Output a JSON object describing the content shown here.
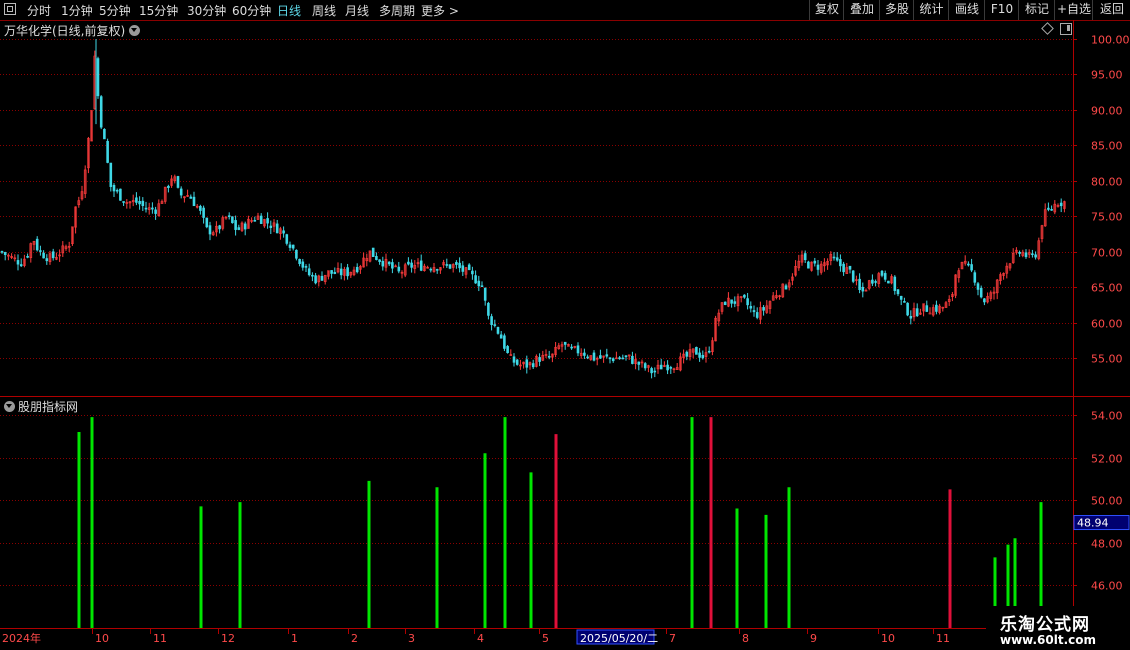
{
  "window": {
    "periods": [
      {
        "label": "分时",
        "active": false
      },
      {
        "label": "1分钟",
        "active": false
      },
      {
        "label": "5分钟",
        "active": false
      },
      {
        "label": "15分钟",
        "active": false
      },
      {
        "label": "30分钟",
        "active": false
      },
      {
        "label": "60分钟",
        "active": false
      },
      {
        "label": "日线",
        "active": true
      },
      {
        "label": "周线",
        "active": false
      },
      {
        "label": "月线",
        "active": false
      },
      {
        "label": "多周期",
        "active": false
      },
      {
        "label": "更多 >",
        "active": false
      }
    ],
    "right_buttons": [
      "复权",
      "叠加",
      "多股",
      "统计",
      "画线",
      "F10",
      "标记",
      "+自选",
      "返回"
    ]
  },
  "main_panel": {
    "title": "万华化学(日线,前复权)"
  },
  "indicator_panel": {
    "title": "股朋指标网"
  },
  "footer": {
    "logo_cn": "乐淘公式网",
    "logo_url": "www.60lt.com"
  },
  "colors": {
    "up": "#ff3c3c",
    "down": "#3fd8e6",
    "ind_green": "#00e600",
    "ind_red": "#e0103a",
    "grid": "#8a0000",
    "axis_text": "#ff4a4a",
    "cursor_bg": "#000070"
  },
  "chart_data": [
    {
      "type": "candlestick",
      "title": "万华化学(日线,前复权)",
      "y_ticks": [
        55,
        60,
        65,
        70,
        75,
        80,
        85,
        90,
        95,
        100
      ],
      "y_tick_labels": [
        "55.00",
        "60.00",
        "65.00",
        "70.00",
        "75.00",
        "80.00",
        "85.00",
        "90.00",
        "95.00",
        "100.00"
      ],
      "approx_close_path": [
        [
          0,
          70
        ],
        [
          12,
          69
        ],
        [
          20,
          68.5
        ],
        [
          26,
          69.5
        ],
        [
          32,
          72
        ],
        [
          38,
          70
        ],
        [
          50,
          69
        ],
        [
          60,
          70
        ],
        [
          68,
          71
        ],
        [
          74,
          76
        ],
        [
          80,
          78
        ],
        [
          86,
          84
        ],
        [
          90,
          89
        ],
        [
          94,
          98
        ],
        [
          98,
          90
        ],
        [
          104,
          85
        ],
        [
          110,
          79
        ],
        [
          118,
          78
        ],
        [
          126,
          77
        ],
        [
          136,
          77
        ],
        [
          146,
          76
        ],
        [
          156,
          76
        ],
        [
          166,
          79
        ],
        [
          172,
          81
        ],
        [
          178,
          78
        ],
        [
          188,
          78
        ],
        [
          198,
          76
        ],
        [
          206,
          73
        ],
        [
          216,
          73
        ],
        [
          226,
          75
        ],
        [
          236,
          73
        ],
        [
          246,
          74
        ],
        [
          256,
          75
        ],
        [
          268,
          74
        ],
        [
          280,
          73
        ],
        [
          290,
          71
        ],
        [
          298,
          69
        ],
        [
          306,
          67
        ],
        [
          316,
          66
        ],
        [
          326,
          67
        ],
        [
          336,
          67
        ],
        [
          346,
          67
        ],
        [
          358,
          68
        ],
        [
          368,
          70
        ],
        [
          378,
          69
        ],
        [
          388,
          68
        ],
        [
          398,
          67
        ],
        [
          410,
          68
        ],
        [
          422,
          68
        ],
        [
          434,
          68
        ],
        [
          444,
          68
        ],
        [
          454,
          68
        ],
        [
          466,
          67
        ],
        [
          476,
          66
        ],
        [
          482,
          65
        ],
        [
          486,
          61
        ],
        [
          492,
          60
        ],
        [
          500,
          58
        ],
        [
          508,
          55
        ],
        [
          518,
          54
        ],
        [
          528,
          54
        ],
        [
          538,
          55
        ],
        [
          550,
          55
        ],
        [
          560,
          57
        ],
        [
          570,
          56
        ],
        [
          580,
          56
        ],
        [
          592,
          55
        ],
        [
          604,
          55
        ],
        [
          616,
          55
        ],
        [
          628,
          55
        ],
        [
          640,
          54
        ],
        [
          652,
          53
        ],
        [
          662,
          54
        ],
        [
          672,
          54
        ],
        [
          684,
          55
        ],
        [
          694,
          56
        ],
        [
          704,
          55
        ],
        [
          710,
          57
        ],
        [
          716,
          61
        ],
        [
          724,
          63
        ],
        [
          734,
          63
        ],
        [
          744,
          63
        ],
        [
          754,
          61
        ],
        [
          764,
          62
        ],
        [
          774,
          64
        ],
        [
          784,
          65
        ],
        [
          792,
          67
        ],
        [
          800,
          69
        ],
        [
          810,
          68
        ],
        [
          820,
          68
        ],
        [
          830,
          69
        ],
        [
          840,
          68
        ],
        [
          850,
          67
        ],
        [
          860,
          64
        ],
        [
          870,
          66
        ],
        [
          880,
          67
        ],
        [
          890,
          66
        ],
        [
          900,
          63
        ],
        [
          910,
          61
        ],
        [
          920,
          62
        ],
        [
          930,
          62
        ],
        [
          940,
          62
        ],
        [
          950,
          63
        ],
        [
          956,
          68
        ],
        [
          964,
          68
        ],
        [
          972,
          67
        ],
        [
          982,
          63
        ],
        [
          992,
          64
        ],
        [
          1000,
          67
        ],
        [
          1010,
          69
        ],
        [
          1020,
          70
        ],
        [
          1030,
          69
        ],
        [
          1036,
          70
        ],
        [
          1042,
          75
        ],
        [
          1050,
          76
        ],
        [
          1056,
          77
        ],
        [
          1062,
          77
        ]
      ]
    },
    {
      "type": "bar",
      "title": "股朋指标网",
      "y_ticks": [
        46,
        48,
        50,
        52,
        54
      ],
      "y_tick_labels": [
        "46.00",
        "48.00",
        "50.00",
        "52.00",
        "54.00"
      ],
      "cursor_value": "48.94",
      "x_tick_labels": [
        "2024年",
        "10",
        "11",
        "12",
        "1",
        "2",
        "3",
        "4",
        "5",
        "2025/05/20/二",
        "7",
        "8",
        "9",
        "10",
        "11"
      ],
      "bars": [
        {
          "x": 79,
          "top": 53.2,
          "color": "green"
        },
        {
          "x": 92,
          "top": 53.9,
          "color": "green"
        },
        {
          "x": 201,
          "top": 49.7,
          "color": "green"
        },
        {
          "x": 240,
          "top": 49.9,
          "color": "green"
        },
        {
          "x": 369,
          "top": 50.9,
          "color": "green"
        },
        {
          "x": 437,
          "top": 50.6,
          "color": "green"
        },
        {
          "x": 485,
          "top": 52.2,
          "color": "green"
        },
        {
          "x": 505,
          "top": 53.9,
          "color": "green"
        },
        {
          "x": 531,
          "top": 51.3,
          "color": "green"
        },
        {
          "x": 556,
          "top": 53.1,
          "color": "red"
        },
        {
          "x": 692,
          "top": 53.9,
          "color": "green"
        },
        {
          "x": 711,
          "top": 53.9,
          "color": "red"
        },
        {
          "x": 737,
          "top": 49.6,
          "color": "green"
        },
        {
          "x": 766,
          "top": 49.3,
          "color": "green"
        },
        {
          "x": 789,
          "top": 50.6,
          "color": "green"
        },
        {
          "x": 950,
          "top": 50.5,
          "color": "red"
        },
        {
          "x": 995,
          "top": 47.3,
          "color": "green"
        },
        {
          "x": 1008,
          "top": 47.9,
          "color": "green"
        },
        {
          "x": 1015,
          "top": 48.2,
          "color": "green"
        },
        {
          "x": 1041,
          "top": 49.9,
          "color": "green"
        }
      ]
    }
  ]
}
